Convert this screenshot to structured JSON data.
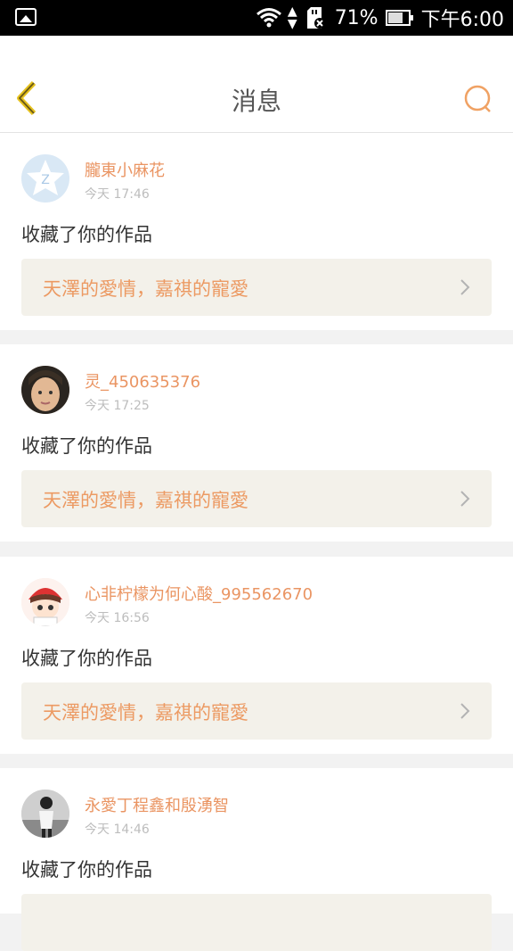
{
  "status_bar": {
    "battery": "71%",
    "time": "下午6:00"
  },
  "header": {
    "title": "消息"
  },
  "messages": [
    {
      "username": "朧東小麻花",
      "time": "今天 17:46",
      "action": "收藏了你的作品",
      "work_title": "天澤的愛情，嘉祺的寵愛"
    },
    {
      "username": "灵_450635376",
      "time": "今天 17:25",
      "action": "收藏了你的作品",
      "work_title": "天澤的愛情，嘉祺的寵愛"
    },
    {
      "username": "心非柠檬为何心酸_995562670",
      "time": "今天 16:56",
      "action": "收藏了你的作品",
      "work_title": "天澤的愛情，嘉祺的寵愛"
    },
    {
      "username": "永愛丁程鑫和殷湧智",
      "time": "今天 14:46",
      "action": "收藏了你的作品",
      "work_title": ""
    }
  ],
  "colors": {
    "accent": "#ea9563",
    "back_icon": "#e6c21e",
    "work_box_bg": "#f3f1ea"
  }
}
